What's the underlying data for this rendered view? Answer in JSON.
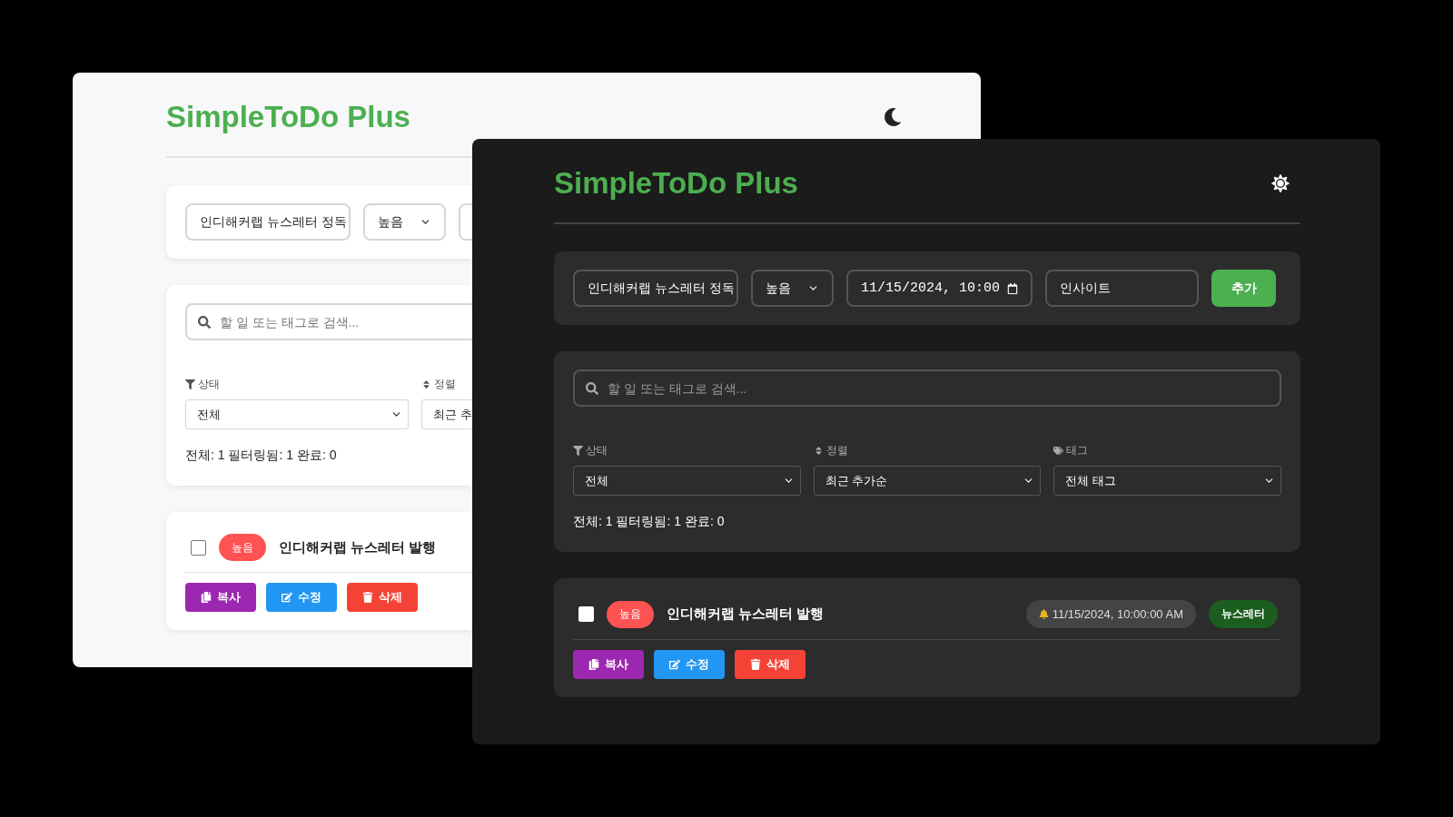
{
  "windows": [
    {
      "kind": "light",
      "title": "SimpleToDo Plus",
      "add_form": [
        {
          "kind": "text",
          "value": "인디해커랩 뉴스레터 정독"
        },
        {
          "kind": "select",
          "value": "높음"
        },
        {
          "kind": "date"
        }
      ],
      "search": {
        "placeholder": "할 일 또는 태그로 검색..."
      },
      "filters": [
        {
          "kind": "status",
          "label": "상태",
          "value": "전체"
        },
        {
          "kind": "sort",
          "label": "정렬",
          "value": "최근 추"
        }
      ],
      "stats": "전체: 1 필터링됨: 1 완료: 0",
      "tasks": [
        {
          "checked": false,
          "color": "#ff5252",
          "priority_label": "높음",
          "title": "인디해커랩 뉴스레터 발행",
          "actions": [
            {
              "kind": "copy",
              "label": "복사"
            },
            {
              "kind": "edit",
              "label": "수정"
            },
            {
              "kind": "delete",
              "label": "삭제"
            }
          ]
        }
      ]
    },
    {
      "kind": "dark",
      "title": "SimpleToDo Plus",
      "add_form": [
        {
          "kind": "text",
          "value": "인디해커랩 뉴스레터 정독"
        },
        {
          "kind": "select",
          "value": "높음"
        },
        {
          "kind": "date",
          "value": "11/15/2024, 10:00"
        },
        {
          "kind": "text",
          "value": "인사이트"
        },
        {
          "kind": "button",
          "value": "추가"
        }
      ],
      "search": {
        "placeholder": "할 일 또는 태그로 검색..."
      },
      "filters": [
        {
          "kind": "status",
          "label": "상태",
          "value": "전체"
        },
        {
          "kind": "sort",
          "label": "정렬",
          "value": "최근 추가순"
        },
        {
          "kind": "tag",
          "label": "태그",
          "value": "전체 태그"
        }
      ],
      "stats": "전체: 1 필터링됨: 1 완료: 0",
      "tasks": [
        {
          "checked": false,
          "color": "#ff5252",
          "priority_label": "높음",
          "title": "인디해커랩 뉴스레터 발행",
          "due": "11/15/2024, 10:00:00 AM",
          "tags": [
            "뉴스레터"
          ],
          "actions": [
            {
              "kind": "copy",
              "label": "복사"
            },
            {
              "kind": "edit",
              "label": "수정"
            },
            {
              "kind": "delete",
              "label": "삭제"
            }
          ]
        }
      ]
    }
  ]
}
